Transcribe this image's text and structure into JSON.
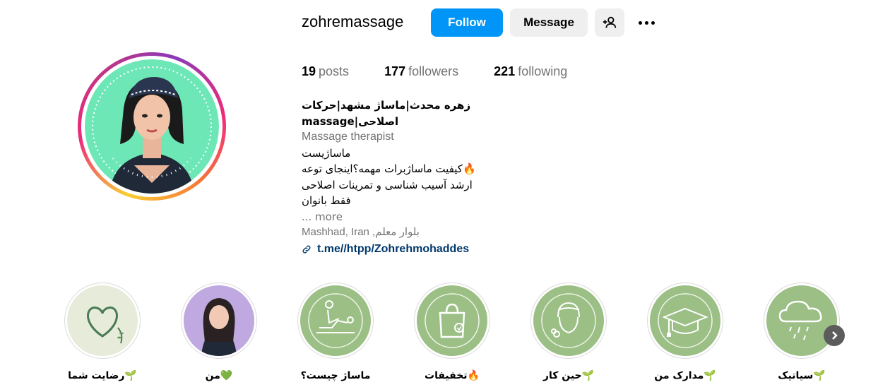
{
  "profile": {
    "username": "zohremassage",
    "follow_label": "Follow",
    "message_label": "Message",
    "add_user_icon": "add-user-icon",
    "more_icon": "more-icon"
  },
  "stats": {
    "posts_count": "19",
    "posts_label": "posts",
    "followers_count": "177",
    "followers_label": "followers",
    "following_count": "221",
    "following_label": "following"
  },
  "bio": {
    "name": "زهره محدث|ماساژ مشهد|حرکات اصلاحی|massage",
    "category": "Massage therapist",
    "lines": [
      "ماساژیست",
      "🔥کیفیت ماساژبرات مهمه؟اینجای توعه",
      "ارشد آسیب شناسی و تمرینات اصلاحی",
      "فقط بانوان"
    ],
    "more_label": "... more",
    "location": "Mashhad, Iran ,بلوار معلم",
    "link": "t.me//htpp/Zohrehmohaddes"
  },
  "highlights": [
    {
      "label": "🌱رضایت شما",
      "icon": "heart-icon"
    },
    {
      "label": "💚من",
      "icon": "person-photo"
    },
    {
      "label": "ماساژ چیست؟",
      "icon": "massage-icon"
    },
    {
      "label": "🔥تخفیفات",
      "icon": "shopping-bag-icon"
    },
    {
      "label": "🌱حین کار",
      "icon": "face-towel-icon"
    },
    {
      "label": "🌱مدارک من",
      "icon": "graduation-cap-icon"
    },
    {
      "label": "🌱سیاتیک",
      "icon": "rain-cloud-icon"
    }
  ],
  "colors": {
    "follow_blue": "#0095f6",
    "highlight_green": "#9bbf85",
    "link_blue": "#00376b"
  }
}
